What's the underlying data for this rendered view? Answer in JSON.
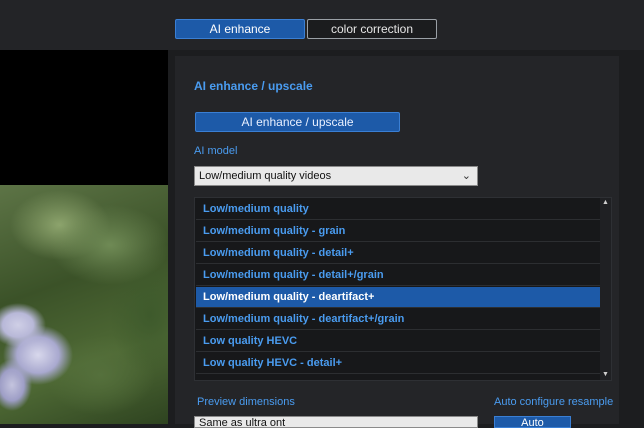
{
  "tabs": [
    {
      "label": "AI enhance",
      "active": true
    },
    {
      "label": "color correction",
      "active": false
    }
  ],
  "section": {
    "title": "AI enhance / upscale",
    "button_label": "AI enhance / upscale"
  },
  "ai_model": {
    "label": "AI model",
    "selected": "Low/medium quality videos"
  },
  "model_list": {
    "items": [
      "Low/medium quality",
      "Low/medium quality - grain",
      "Low/medium quality - detail+",
      "Low/medium quality - detail+/grain",
      "Low/medium quality - deartifact+",
      "Low/medium quality - deartifact+/grain",
      "Low quality HEVC",
      "Low quality HEVC - detail+"
    ],
    "selected_index": 4
  },
  "preview_dimensions": {
    "label": "Preview dimensions",
    "value": "Same as ultra ont"
  },
  "auto_configure": {
    "label": "Auto configure resample",
    "button_label": "Auto"
  },
  "colors": {
    "accent": "#1d5aa8",
    "link_blue": "#4a9cf0",
    "background": "#1c1d1f"
  }
}
